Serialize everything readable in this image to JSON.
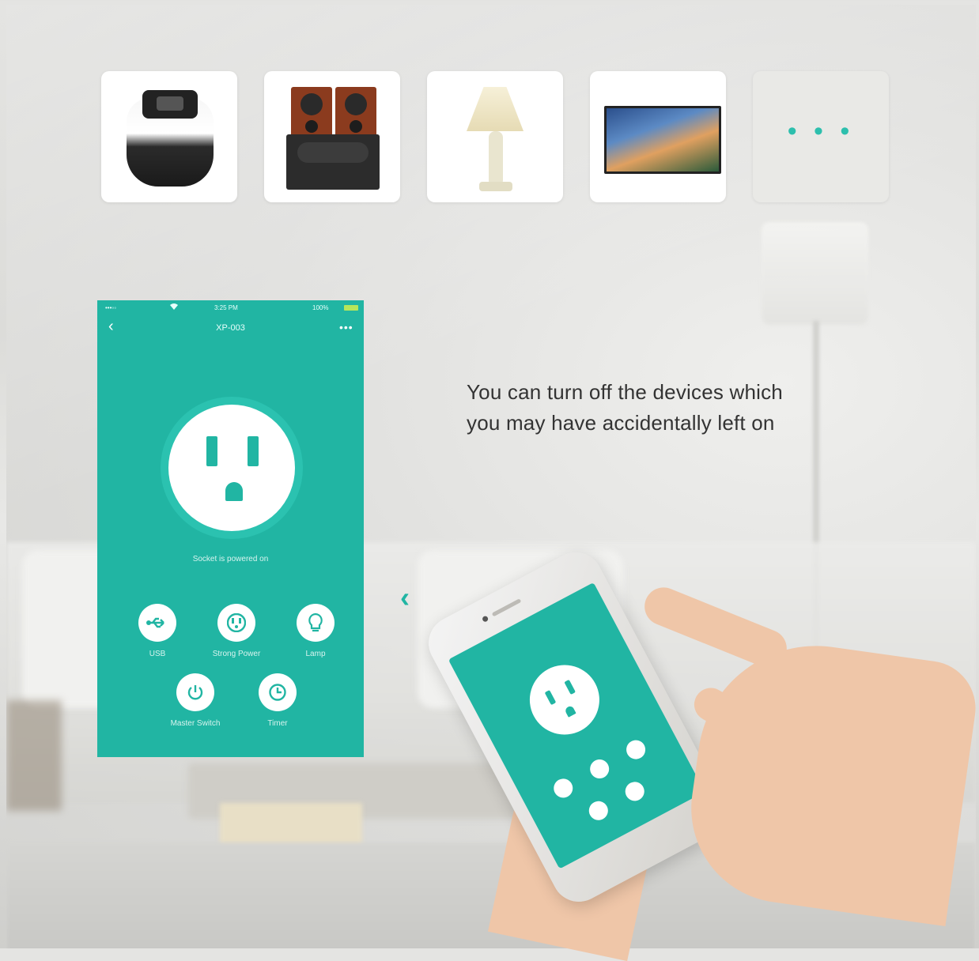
{
  "products": [
    {
      "name": "rice-cooker"
    },
    {
      "name": "speakers-amplifier"
    },
    {
      "name": "table-lamp"
    },
    {
      "name": "television"
    },
    {
      "name": "more",
      "label": "• • •"
    }
  ],
  "headline": {
    "line1": "You can turn off the devices which",
    "line2": "you may have accidentally left on"
  },
  "app": {
    "status": {
      "signal": "•••◦◦",
      "time": "3:25 PM",
      "battery": "100%"
    },
    "nav": {
      "back": "‹",
      "title": "XP-003",
      "more": "•••"
    },
    "socket_status": "Socket is powered on",
    "controls": [
      {
        "icon": "usb-icon",
        "glyph": "⭠",
        "label": "USB"
      },
      {
        "icon": "outlet-icon",
        "glyph": "⠿",
        "label": "Strong Power"
      },
      {
        "icon": "bulb-icon",
        "glyph": "💡",
        "label": "Lamp"
      },
      {
        "icon": "power-icon",
        "glyph": "⏻",
        "label": "Master Switch"
      },
      {
        "icon": "clock-icon",
        "glyph": "◷",
        "label": "Timer"
      }
    ]
  },
  "colors": {
    "accent": "#21b5a3",
    "text": "#333333"
  },
  "swipe_arrow": "‹"
}
